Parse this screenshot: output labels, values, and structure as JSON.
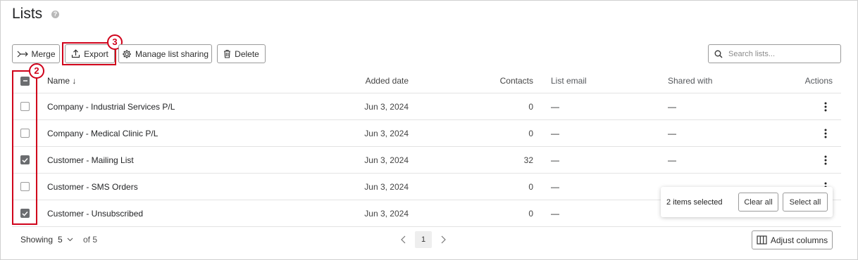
{
  "page": {
    "title": "Lists",
    "help_icon": "?"
  },
  "toolbar": {
    "merge_label": "Merge",
    "export_label": "Export",
    "manage_sharing_label": "Manage list sharing",
    "delete_label": "Delete"
  },
  "callouts": {
    "export": "3",
    "checkboxes": "2"
  },
  "search": {
    "placeholder": "Search lists..."
  },
  "table": {
    "columns": {
      "name": "Name ↓",
      "added_date": "Added date",
      "contacts": "Contacts",
      "list_email": "List email",
      "shared_with": "Shared with",
      "actions": "Actions"
    },
    "rows": [
      {
        "name": "Company - Industrial Services P/L",
        "added_date": "Jun 3, 2024",
        "contacts": "0",
        "list_email": "—",
        "shared_with": "—",
        "checked": false
      },
      {
        "name": "Company - Medical Clinic P/L",
        "added_date": "Jun 3, 2024",
        "contacts": "0",
        "list_email": "—",
        "shared_with": "—",
        "checked": false
      },
      {
        "name": "Customer - Mailing List",
        "added_date": "Jun 3, 2024",
        "contacts": "32",
        "list_email": "—",
        "shared_with": "—",
        "checked": true
      },
      {
        "name": "Customer - SMS Orders",
        "added_date": "Jun 3, 2024",
        "contacts": "0",
        "list_email": "—",
        "shared_with": "—",
        "checked": false
      },
      {
        "name": "Customer - Unsubscribed",
        "added_date": "Jun 3, 2024",
        "contacts": "0",
        "list_email": "—",
        "shared_with": "",
        "checked": true
      }
    ]
  },
  "selection": {
    "text": "2 items selected",
    "clear_all": "Clear all",
    "select_all": "Select all"
  },
  "footer": {
    "showing_label": "Showing",
    "per_page": "5",
    "of_total": "of 5",
    "current_page": "1",
    "adjust_columns_label": "Adjust columns"
  },
  "colors": {
    "callout_red": "#d0021b",
    "checkbox_checked": "#6b6d70"
  }
}
